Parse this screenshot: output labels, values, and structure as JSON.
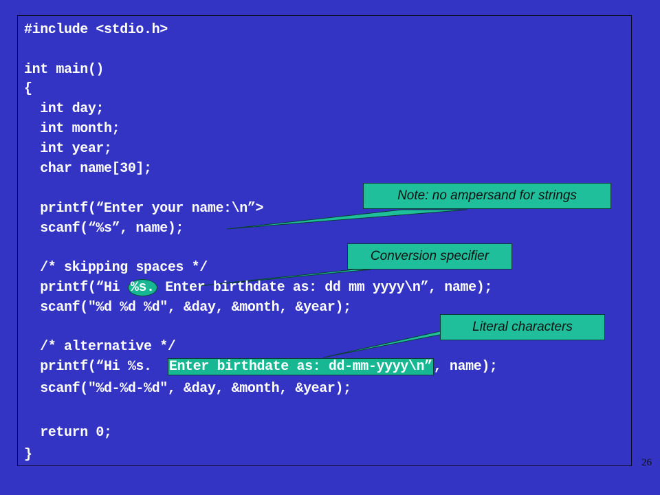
{
  "code": {
    "include": "#include <stdio.h>",
    "main": "int main()",
    "open": "{",
    "decl_day": "  int day;",
    "decl_month": "  int month;",
    "decl_year": "  int year;",
    "decl_name": "  char name[30];",
    "printf_name": "  printf(“Enter your name:\\n”>",
    "scanf_name": "  scanf(“%s”, name);",
    "comment_spaces": "  /* skipping spaces */",
    "printf_hi_pre": "  printf(“Hi ",
    "printf_hi_spec": "%s.",
    "printf_hi_post": " Enter birthdate as: dd mm yyyy\\n”, name);",
    "scanf_spaces": "  scanf(\"%d %d %d\", &day, &month, &year);",
    "comment_alt": "  /* alternative */",
    "printf_alt_pre": "  printf(“Hi %s.  ",
    "printf_alt_literal": "Enter birthdate as: dd-mm-yyyy\\n”",
    "printf_alt_post": ", name);",
    "scanf_dashes": "  scanf(\"%d-%d-%d\", &day, &month, &year);",
    "return": "  return 0;",
    "close": "}"
  },
  "callouts": {
    "ampersand": "Note: no ampersand for strings",
    "conversion": "Conversion specifier",
    "literal": "Literal characters"
  },
  "page_number": "26",
  "colors": {
    "background": "#3434c4",
    "callout": "#1fbf9c",
    "code_text": "#ffffff"
  }
}
